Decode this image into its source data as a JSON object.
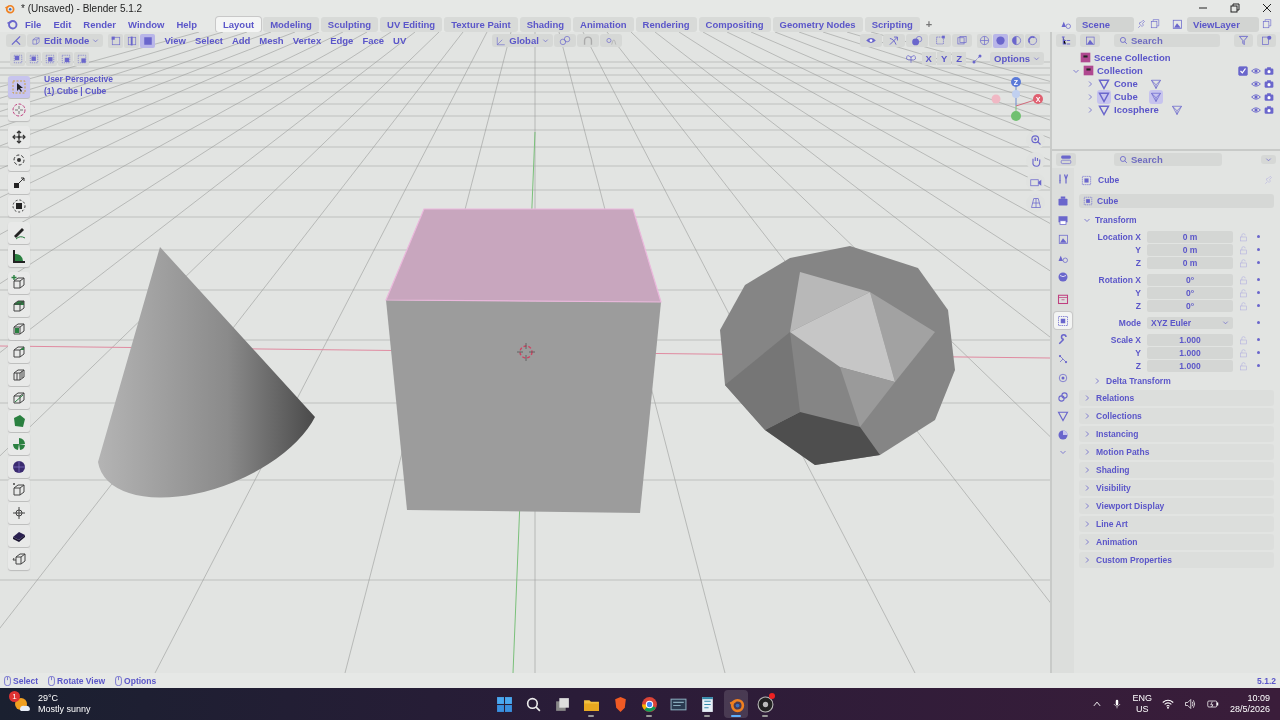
{
  "window": {
    "title": "* (Unsaved) - Blender 5.1.2"
  },
  "menus": [
    "File",
    "Edit",
    "Render",
    "Window",
    "Help"
  ],
  "workspaces": [
    {
      "label": "Layout",
      "selected": true
    },
    {
      "label": "Modeling",
      "selected": false
    },
    {
      "label": "Sculpting",
      "selected": false
    },
    {
      "label": "UV Editing",
      "selected": false
    },
    {
      "label": "Texture Paint",
      "selected": false
    },
    {
      "label": "Shading",
      "selected": false
    },
    {
      "label": "Animation",
      "selected": false
    },
    {
      "label": "Rendering",
      "selected": false
    },
    {
      "label": "Compositing",
      "selected": false
    },
    {
      "label": "Geometry Nodes",
      "selected": false
    },
    {
      "label": "Scripting",
      "selected": false
    }
  ],
  "add_workspace": "+",
  "scene": "Scene",
  "view_layer": "ViewLayer",
  "viewport": {
    "mode": "Edit Mode",
    "select_modes": [
      {
        "kind": "vertex",
        "selected": false
      },
      {
        "kind": "edge",
        "selected": false
      },
      {
        "kind": "face",
        "selected": true
      }
    ],
    "menus": [
      "View",
      "Select",
      "Add",
      "Mesh",
      "Vertex",
      "Edge",
      "Face",
      "UV"
    ],
    "orientation": "Global",
    "shading_modes": [
      {
        "kind": "wireframe",
        "selected": false
      },
      {
        "kind": "solid",
        "selected": true
      },
      {
        "kind": "material",
        "selected": false
      },
      {
        "kind": "rendered",
        "selected": false
      }
    ],
    "mirror_axes": [
      "X",
      "Y",
      "Z"
    ],
    "options": "Options",
    "overlay_text": [
      "User Perspective",
      "(1) Cube | Cube"
    ],
    "gizmo_axes": [
      "Z",
      "X"
    ],
    "tool_groups": [
      [
        {
          "kind": "select",
          "selected": true
        },
        {
          "kind": "cursor",
          "selected": false
        }
      ],
      [
        {
          "kind": "move",
          "selected": false
        },
        {
          "kind": "rotate",
          "selected": false
        },
        {
          "kind": "scale",
          "selected": false
        },
        {
          "kind": "transform",
          "selected": false
        }
      ],
      [
        {
          "kind": "annotate",
          "selected": false
        },
        {
          "kind": "measure",
          "selected": false
        }
      ],
      [
        {
          "kind": "add-cube",
          "selected": false
        },
        {
          "kind": "extrude",
          "selected": false
        },
        {
          "kind": "inset",
          "selected": false
        },
        {
          "kind": "bevel",
          "selected": false
        },
        {
          "kind": "loop-cut",
          "selected": false
        },
        {
          "kind": "knife",
          "selected": false
        },
        {
          "kind": "poly-build",
          "selected": false
        },
        {
          "kind": "spin",
          "selected": false
        },
        {
          "kind": "smooth",
          "selected": false
        },
        {
          "kind": "edge-slide",
          "selected": false
        },
        {
          "kind": "shrink",
          "selected": false
        },
        {
          "kind": "shear",
          "selected": false
        },
        {
          "kind": "rip",
          "selected": false
        }
      ]
    ]
  },
  "outliner": {
    "search_placeholder": "Search",
    "root": "Scene Collection",
    "collections": [
      {
        "label": "Collection",
        "expanded": true,
        "checked": true,
        "children": [
          {
            "label": "Cone",
            "expanded": false,
            "selected": false
          },
          {
            "label": "Cube",
            "expanded": false,
            "selected": true
          },
          {
            "label": "Icosphere",
            "expanded": false,
            "selected": false
          }
        ]
      }
    ]
  },
  "properties": {
    "search_placeholder": "Search",
    "tab_groups": [
      [
        {
          "kind": "tool",
          "selected": false
        }
      ],
      [
        {
          "kind": "render",
          "selected": false
        },
        {
          "kind": "output",
          "selected": false
        },
        {
          "kind": "view-layer",
          "selected": false
        },
        {
          "kind": "scene",
          "selected": false
        },
        {
          "kind": "world",
          "selected": false
        }
      ],
      [
        {
          "kind": "collection",
          "selected": false
        }
      ],
      [
        {
          "kind": "object",
          "selected": true
        },
        {
          "kind": "modifiers",
          "selected": false
        },
        {
          "kind": "particles",
          "selected": false
        },
        {
          "kind": "physics",
          "selected": false
        },
        {
          "kind": "constraints",
          "selected": false
        },
        {
          "kind": "data",
          "selected": false
        },
        {
          "kind": "material",
          "selected": false
        }
      ]
    ],
    "context": "Cube",
    "object_name": "Cube",
    "transform": {
      "label": "Transform",
      "expanded": true,
      "groups": [
        [
          {
            "label": "Location X",
            "value": "0 m",
            "kind": "number"
          },
          {
            "label": "Y",
            "value": "0 m",
            "kind": "number"
          },
          {
            "label": "Z",
            "value": "0 m",
            "kind": "number"
          }
        ],
        [
          {
            "label": "Rotation X",
            "value": "0°",
            "kind": "number"
          },
          {
            "label": "Y",
            "value": "0°",
            "kind": "number"
          },
          {
            "label": "Z",
            "value": "0°",
            "kind": "number"
          }
        ],
        [
          {
            "label": "Mode",
            "value": "XYZ Euler",
            "kind": "dropdown"
          }
        ],
        [
          {
            "label": "Scale X",
            "value": "1.000",
            "kind": "number"
          },
          {
            "label": "Y",
            "value": "1.000",
            "kind": "number"
          },
          {
            "label": "Z",
            "value": "1.000",
            "kind": "number"
          }
        ]
      ],
      "subpanels": [
        {
          "label": "Delta Transform",
          "expanded": false
        }
      ]
    },
    "panels": [
      {
        "label": "Relations",
        "expanded": false
      },
      {
        "label": "Collections",
        "expanded": false
      },
      {
        "label": "Instancing",
        "expanded": false
      },
      {
        "label": "Motion Paths",
        "expanded": false
      },
      {
        "label": "Shading",
        "expanded": false
      },
      {
        "label": "Visibility",
        "expanded": false
      },
      {
        "label": "Viewport Display",
        "expanded": false
      },
      {
        "label": "Line Art",
        "expanded": false
      },
      {
        "label": "Animation",
        "expanded": false
      },
      {
        "label": "Custom Properties",
        "expanded": false
      }
    ]
  },
  "status_bar": {
    "hints": [
      "Select",
      "Rotate View",
      "Options"
    ],
    "version": "5.1.2"
  },
  "taskbar": {
    "weather": {
      "badge": "1",
      "temperature": "29°C",
      "condition": "Mostly sunny"
    },
    "apps": [
      {
        "kind": "start",
        "running": false,
        "selected": false,
        "alert": false
      },
      {
        "kind": "search",
        "running": false,
        "selected": false,
        "alert": false
      },
      {
        "kind": "task-view",
        "running": false,
        "selected": false,
        "alert": false
      },
      {
        "kind": "files",
        "running": true,
        "selected": false,
        "alert": false
      },
      {
        "kind": "shield",
        "running": false,
        "selected": false,
        "alert": false
      },
      {
        "kind": "browser",
        "running": true,
        "selected": false,
        "alert": false
      },
      {
        "kind": "window",
        "running": false,
        "selected": false,
        "alert": false
      },
      {
        "kind": "notepad",
        "running": true,
        "selected": false,
        "alert": false
      },
      {
        "kind": "ring",
        "running": true,
        "selected": true,
        "alert": false
      },
      {
        "kind": "disc",
        "running": true,
        "selected": false,
        "alert": true
      }
    ],
    "language": "ENG",
    "region": "US",
    "time": "10:09",
    "date": "28/5/2026"
  }
}
